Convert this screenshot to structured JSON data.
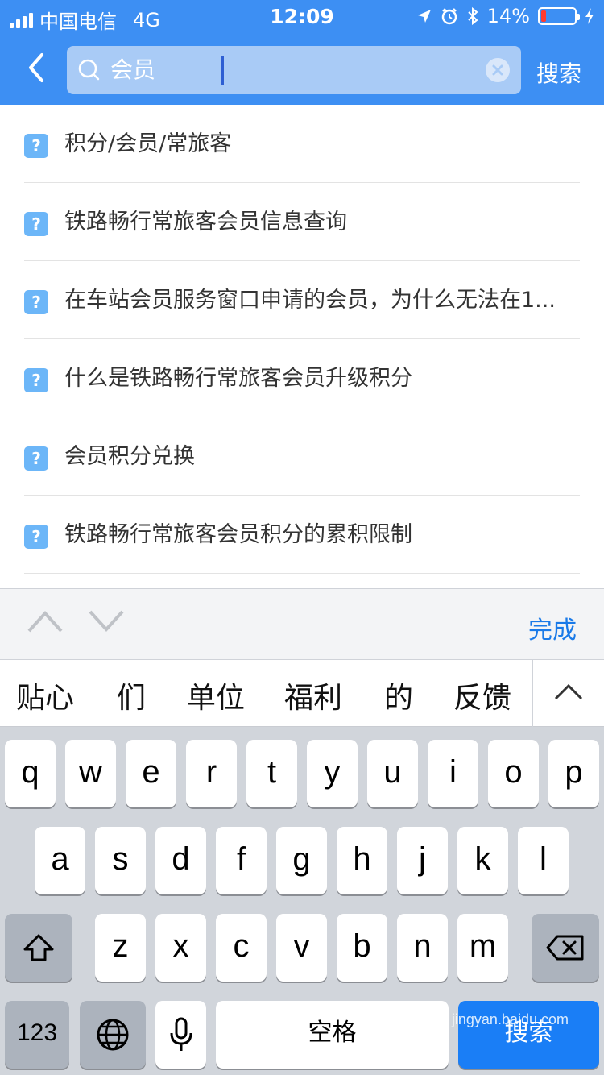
{
  "status": {
    "carrier": "中国电信",
    "network": "4G",
    "time": "12:09",
    "battery": "14%",
    "battery_level": 0.14
  },
  "header": {
    "search_query": "会员",
    "search_button": "搜索"
  },
  "results": [
    {
      "text": "积分/会员/常旅客"
    },
    {
      "text": "铁路畅行常旅客会员信息查询"
    },
    {
      "text": "在车站会员服务窗口申请的会员，为什么无法在1..."
    },
    {
      "text": "什么是铁路畅行常旅客会员升级积分"
    },
    {
      "text": "会员积分兑换"
    },
    {
      "text": "铁路畅行常旅客会员积分的累积限制"
    }
  ],
  "accessory": {
    "done_label": "完成"
  },
  "candidates": [
    "贴心",
    "们",
    "单位",
    "福利",
    "的",
    "反馈"
  ],
  "keyboard": {
    "row1": [
      "q",
      "w",
      "e",
      "r",
      "t",
      "y",
      "u",
      "i",
      "o",
      "p"
    ],
    "row2": [
      "a",
      "s",
      "d",
      "f",
      "g",
      "h",
      "j",
      "k",
      "l"
    ],
    "row3": [
      "z",
      "x",
      "c",
      "v",
      "b",
      "n",
      "m"
    ],
    "numbers_label": "123",
    "space_label": "空格",
    "search_label": "搜索"
  },
  "watermark": "jingyan.baidu.com",
  "colors": {
    "header_bg": "#3d8ff3",
    "accent": "#1a7ae8",
    "question_icon": "#6cb6f8"
  }
}
